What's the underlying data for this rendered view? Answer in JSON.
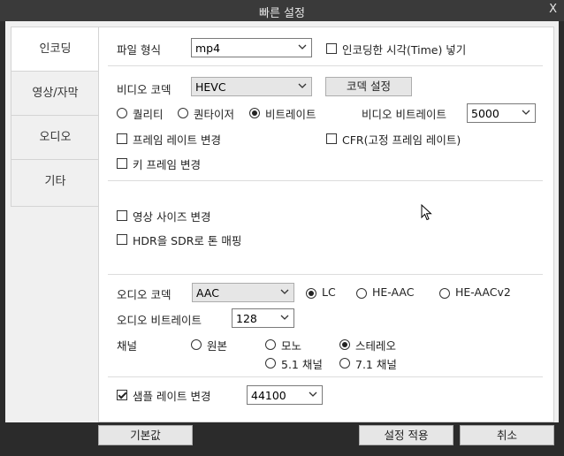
{
  "window": {
    "title": "빠른 설정",
    "close_glyph": "X"
  },
  "sidebar": {
    "items": [
      {
        "label": "인코딩",
        "active": true
      },
      {
        "label": "영상/자막",
        "active": false
      },
      {
        "label": "오디오",
        "active": false
      },
      {
        "label": "기타",
        "active": false
      }
    ]
  },
  "encoding": {
    "file_format_label": "파일 형식",
    "file_format_value": "mp4",
    "insert_time_label": "인코딩한 시각(Time) 넣기",
    "video_codec_label": "비디오 코덱",
    "video_codec_value": "HEVC",
    "codec_settings_button": "코덱 설정",
    "mode_quality": "퀄리티",
    "mode_quantizer": "퀀타이저",
    "mode_bitrate": "비트레이트",
    "video_bitrate_label": "비디오 비트레이트",
    "video_bitrate_value": "5000",
    "change_framerate": "프레임 레이트 변경",
    "cfr": "CFR(고정 프레임 레이트)",
    "change_keyframe": "키 프레임 변경",
    "change_video_size": "영상 사이즈 변경",
    "hdr_to_sdr": "HDR을 SDR로 톤 매핑",
    "audio_codec_label": "오디오 코덱",
    "audio_codec_value": "AAC",
    "aac_lc": "LC",
    "aac_he": "HE-AAC",
    "aac_hev2": "HE-AACv2",
    "audio_bitrate_label": "오디오 비트레이트",
    "audio_bitrate_value": "128",
    "channel_label": "채널",
    "ch_original": "원본",
    "ch_mono": "모노",
    "ch_stereo": "스테레오",
    "ch_51": "5.1 채널",
    "ch_71": "7.1 채널",
    "change_samplerate": "샘플 레이트 변경",
    "samplerate_value": "44100"
  },
  "footer": {
    "default_button": "기본값",
    "apply_button": "설정 적용",
    "cancel_button": "취소"
  },
  "state": {
    "insert_time_checked": false,
    "mode_selected": "bitrate",
    "change_framerate_checked": false,
    "cfr_checked": false,
    "change_keyframe_checked": false,
    "change_video_size_checked": false,
    "hdr_to_sdr_checked": false,
    "aac_profile_selected": "LC",
    "channel_selected": "stereo",
    "change_samplerate_checked": true
  }
}
